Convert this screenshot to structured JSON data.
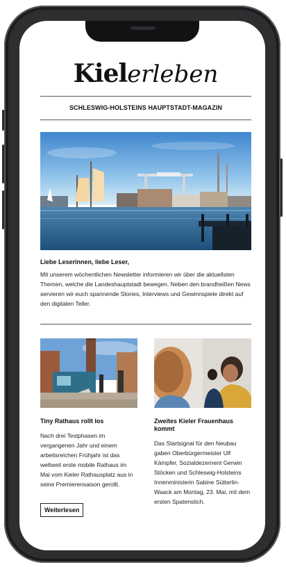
{
  "brand": {
    "logo_part1": "Kiel",
    "logo_part2": "erleben"
  },
  "tagline": "SCHLESWIG-HOLSTEINS HAUPTSTADT-MAGAZIN",
  "intro": {
    "title": "Liebe Leserinnen, liebe Leser,",
    "text": "Mit unserem wöchentlichen Newsletter informieren wir über die aktuellsten Themen, welche die Landeshauptstadt bewegen. Neben den brandheißen News servieren wir euch spannende Stories, Interviews und Gewinnspiele direkt auf den digitalen Teller."
  },
  "articles": [
    {
      "title": "Tiny Rathaus rollt los",
      "text": "Nach drei Testphasen im vergangenen Jahr und einem arbeitsreichen Frühjahr ist das weltweit erste mobile Rathaus im Mai vom Kieler Rathausplatz aus in seine Premierensaison gerollt.",
      "button": "Weiterlesen"
    },
    {
      "title": "Zweites Kieler Frauenhaus kommt",
      "text": "Das Startsignal für den Neubau gaben Oberbürgermeister Ulf Kämpfer, Sozialdezernent Gerwin Stöcken und Schleswig-Holsteins Innenministerin Sabine Sütterlin-Waack am Montag, 23. Mai, mit dem ersten Spatenstich."
    }
  ]
}
